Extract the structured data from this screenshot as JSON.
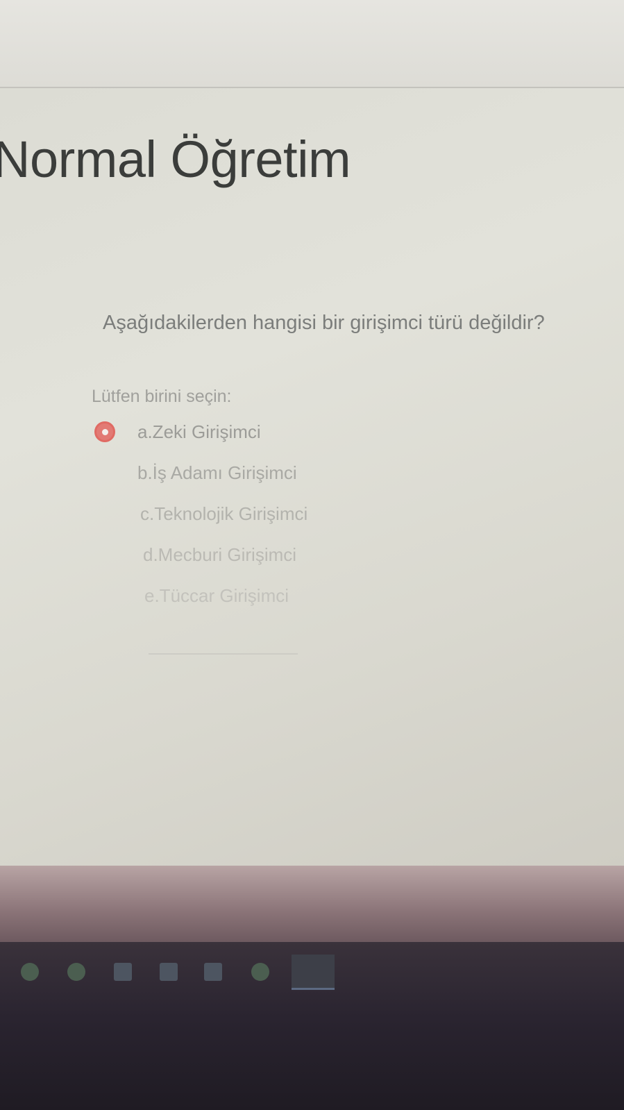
{
  "page": {
    "title": "Normal Öğretim"
  },
  "quiz": {
    "question": "Aşağıdakilerden hangisi bir girişimci türü değildir?",
    "prompt": "Lütfen birini seçin:",
    "options": [
      {
        "label": "a.Zeki Girişimci",
        "selected": true
      },
      {
        "label": "b.İş Adamı Girişimci",
        "selected": false
      },
      {
        "label": "c.Teknolojik Girişimci",
        "selected": false
      },
      {
        "label": "d.Mecburi Girişimci",
        "selected": false
      },
      {
        "label": "e.Tüccar Girişimci",
        "selected": false
      }
    ]
  },
  "taskbar": {
    "icons": [
      "whatsapp-icon",
      "chrome-icon",
      "file-explorer-icon",
      "visual-studio-icon",
      "app-icon",
      "settings-icon",
      "active-app-icon"
    ]
  },
  "colors": {
    "selected_radio": "#e27a74",
    "title_text": "#3b3d3b",
    "question_text": "#7b7d7b"
  }
}
